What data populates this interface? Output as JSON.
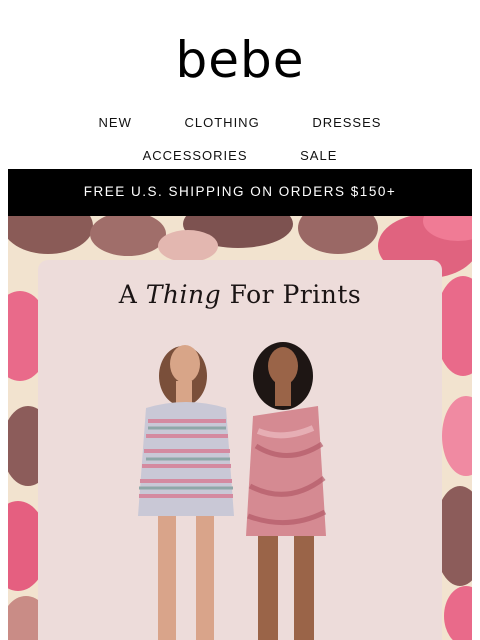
{
  "brand": {
    "logo": "bebe"
  },
  "nav": {
    "row1": [
      {
        "label": "NEW"
      },
      {
        "label": "CLOTHING"
      },
      {
        "label": "DRESSES"
      }
    ],
    "row2": [
      {
        "label": "ACCESSORIES"
      },
      {
        "label": "SALE"
      }
    ]
  },
  "banner": {
    "text": "FREE U.S. SHIPPING ON ORDERS $150+"
  },
  "hero": {
    "title_pre": "A ",
    "title_em": "Thing",
    "title_post": " For Prints"
  },
  "colors": {
    "banner_bg": "#000000",
    "floral_pink": "#e96a8a",
    "floral_mauve": "#8c5c5a",
    "panel_pink": "#eddcda"
  }
}
